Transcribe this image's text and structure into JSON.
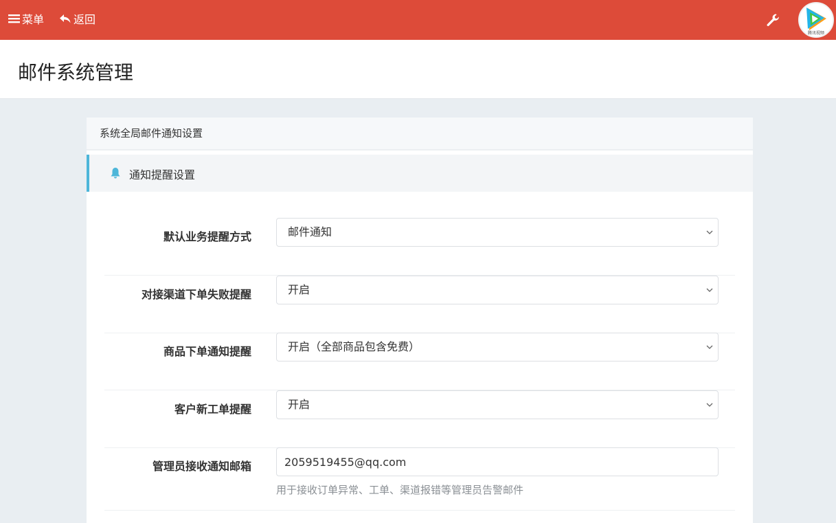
{
  "topbar": {
    "menu_label": "菜单",
    "back_label": "返回",
    "color": "#dd4b39",
    "avatar_text": "腾讯视频"
  },
  "page": {
    "title": "邮件系统管理"
  },
  "panel": {
    "title": "系统全局邮件通知设置",
    "section_title": "通知提醒设置",
    "section_accent": "#4db6d9"
  },
  "form": {
    "rows": [
      {
        "label": "默认业务提醒方式",
        "value": "邮件通知"
      },
      {
        "label": "对接渠道下单失败提醒",
        "value": "开启"
      },
      {
        "label": "商品下单通知提醒",
        "value": "开启（全部商品包含免费）"
      },
      {
        "label": "客户新工单提醒",
        "value": "开启"
      }
    ],
    "admin_email": {
      "label": "管理员接收通知邮箱",
      "value": "2059519455@qq.com",
      "help": "用于接收订单异常、工单、渠道报错等管理员告警邮件"
    }
  }
}
